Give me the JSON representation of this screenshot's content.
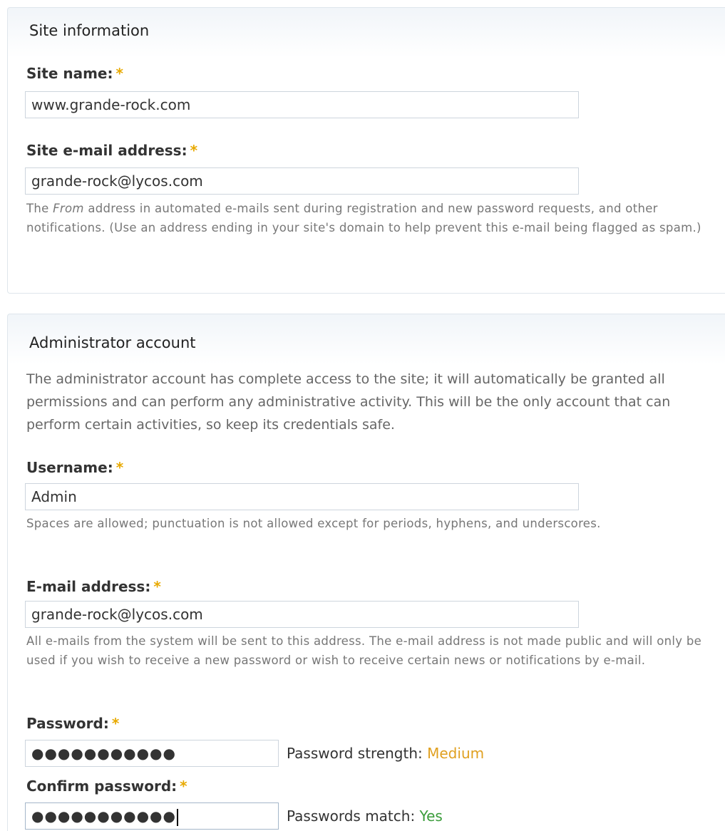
{
  "site_information": {
    "legend": "Site information",
    "site_name": {
      "label": "Site name:",
      "required_mark": "*",
      "value": "www.grande-rock.com"
    },
    "site_email": {
      "label": "Site e-mail address:",
      "required_mark": "*",
      "value": "grande-rock@lycos.com",
      "description_prefix": "The ",
      "description_emphasis": "From",
      "description_suffix": " address in automated e-mails sent during registration and new password requests, and other notifications. (Use an address ending in your site's domain to help prevent this e-mail being flagged as spam.)"
    }
  },
  "administrator_account": {
    "legend": "Administrator account",
    "intro": "The administrator account has complete access to the site; it will automatically be granted all permissions and can perform any administrative activity. This will be the only account that can perform certain activities, so keep its credentials safe.",
    "username": {
      "label": "Username:",
      "required_mark": "*",
      "value": "Admin",
      "description": "Spaces are allowed; punctuation is not allowed except for periods, hyphens, and underscores."
    },
    "email": {
      "label": "E-mail address:",
      "required_mark": "*",
      "value": "grande-rock@lycos.com",
      "description": "All e-mails from the system will be sent to this address. The e-mail address is not made public and will only be used if you wish to receive a new password or wish to receive certain news or notifications by e-mail."
    },
    "password": {
      "label": "Password:",
      "required_mark": "*",
      "masked_value": "●●●●●●●●●●●",
      "strength_label": "Password strength:",
      "strength_value": "Medium"
    },
    "confirm_password": {
      "label": "Confirm password:",
      "required_mark": "*",
      "masked_value": "●●●●●●●●●●●",
      "match_label": "Passwords match:",
      "match_value": "Yes"
    }
  },
  "colors": {
    "required_mark": "#e8a900",
    "strength_medium": "#e0a020",
    "match_yes": "#3a9c3a",
    "fieldset_border": "#dfe6ec"
  }
}
